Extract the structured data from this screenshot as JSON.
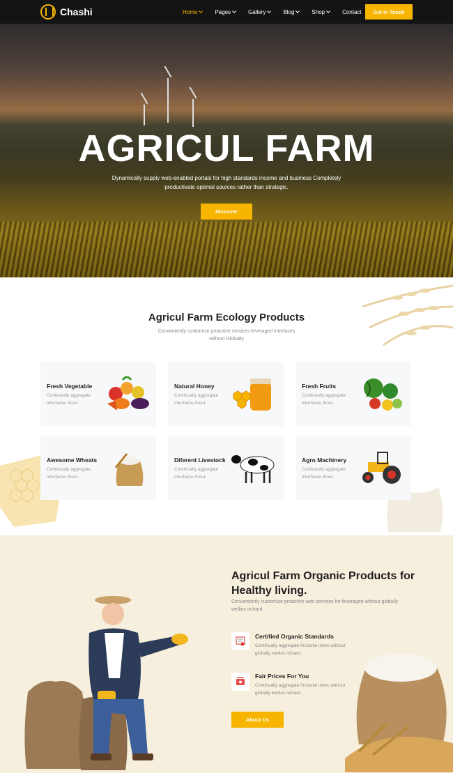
{
  "nav": {
    "logo_text": "Chashi",
    "items": [
      {
        "label": "Home",
        "has_dropdown": true,
        "active": true
      },
      {
        "label": "Pages",
        "has_dropdown": true,
        "active": false
      },
      {
        "label": "Gallery",
        "has_dropdown": true,
        "active": false
      },
      {
        "label": "Blog",
        "has_dropdown": true,
        "active": false
      },
      {
        "label": "Shop",
        "has_dropdown": true,
        "active": false
      },
      {
        "label": "Contact",
        "has_dropdown": false,
        "active": false
      }
    ],
    "cta_label": "Get In Touch"
  },
  "hero": {
    "title": "AGRICUL FARM",
    "subtitle": "Dynamically supply web-enabled portals for high standards income and business Completely productivate optimal sources rather than strategic.",
    "button_label": "Discover"
  },
  "products": {
    "title": "Agricul Farm Ecology Products",
    "subtitle": "Conveniently customize proactive services leveraged interfaces without Globally",
    "cards": [
      {
        "title": "Fresh Vegetable",
        "text": "Continually aggregate interfaces thout.",
        "icon": "vegetables-icon"
      },
      {
        "title": "Natural Honey",
        "text": "Continually aggregate interfaces thout.",
        "icon": "honey-jar-icon"
      },
      {
        "title": "Fresh Fruits",
        "text": "Continually aggregate interfaces thout.",
        "icon": "fruits-icon"
      },
      {
        "title": "Awesome Wheats",
        "text": "Continually aggregate interfaces thout.",
        "icon": "wheat-sack-icon"
      },
      {
        "title": "Diferent Livestock",
        "text": "Continually aggregate interfaces thout.",
        "icon": "cow-icon"
      },
      {
        "title": "Agro Machinery",
        "text": "Continually aggregate interfaces thout.",
        "icon": "tractor-icon"
      }
    ]
  },
  "about": {
    "title": "Agricul Farm Organic Products for Healthy living.",
    "text": "Conveniently customize proactive web services for leveraged without globally wellies richard.",
    "features": [
      {
        "title": "Certified Organic Standards",
        "text": "Continually aggregate frictionle interc without globally wellies richard.",
        "icon": "certificate-icon"
      },
      {
        "title": "Fair Prices For You",
        "text": "Continually aggregate frictionle interc without globally wellies richard.",
        "icon": "price-tag-icon"
      }
    ],
    "button_label": "About Us"
  },
  "colors": {
    "accent": "#f7b500",
    "nav_bg": "#141414",
    "about_bg": "#f6efdd",
    "card_bg": "#f7f8fa"
  }
}
